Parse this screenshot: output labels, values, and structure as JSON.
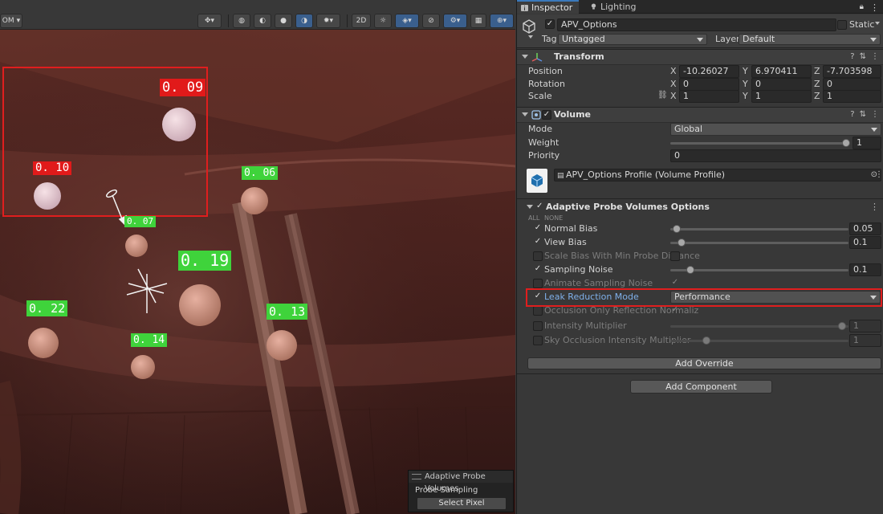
{
  "scene": {
    "toolbar": {
      "left_dropdown": "OM",
      "view_2d": "2D"
    },
    "probes": [
      {
        "label": "0. 09",
        "style": "red"
      },
      {
        "label": "0. 10",
        "style": "red"
      },
      {
        "label": "0. 06",
        "style": "green"
      },
      {
        "label": "0. 07",
        "style": "green"
      },
      {
        "label": "0. 19",
        "style": "green"
      },
      {
        "label": "0. 22",
        "style": "green"
      },
      {
        "label": "0. 14",
        "style": "green"
      },
      {
        "label": "0. 13",
        "style": "green"
      }
    ],
    "overlay": {
      "title": "Adaptive Probe Volumes",
      "subtitle": "Probe Sampling",
      "button": "Select Pixel"
    }
  },
  "inspector": {
    "tabs": [
      {
        "label": "Inspector",
        "icon": "info-icon",
        "active": true
      },
      {
        "label": "Lighting",
        "icon": "bulb-icon",
        "active": false
      }
    ],
    "object": {
      "name": "APV_Options",
      "static_label": "Static",
      "tag_label": "Tag",
      "tag_value": "Untagged",
      "layer_label": "Layer",
      "layer_value": "Default"
    },
    "transform": {
      "title": "Transform",
      "position_label": "Position",
      "rotation_label": "Rotation",
      "scale_label": "Scale",
      "position": {
        "x": "-10.26027",
        "y": "6.970411",
        "z": "-7.703598"
      },
      "rotation": {
        "x": "0",
        "y": "0",
        "z": "0"
      },
      "scale": {
        "x": "1",
        "y": "1",
        "z": "1"
      }
    },
    "volume": {
      "title": "Volume",
      "mode_label": "Mode",
      "mode_value": "Global",
      "weight_label": "Weight",
      "weight_value": "1",
      "priority_label": "Priority",
      "priority_value": "0",
      "profile_value": "APV_Options Profile (Volume Profile)"
    },
    "apv": {
      "title": "Adaptive Probe Volumes Options",
      "all_label": "ALL",
      "none_label": "NONE",
      "rows": [
        {
          "label": "Normal Bias",
          "value": "0.05",
          "override": true,
          "slider": 0.02
        },
        {
          "label": "View Bias",
          "value": "0.1",
          "override": true,
          "slider": 0.05
        },
        {
          "label": "Scale Bias With Min Probe Distance",
          "override": false
        },
        {
          "label": "Sampling Noise",
          "value": "0.1",
          "override": true,
          "slider": 0.1
        },
        {
          "label": "Animate Sampling Noise",
          "override": false
        },
        {
          "label": "Leak Reduction Mode",
          "value": "Performance",
          "override": true
        },
        {
          "label": "Occlusion Only Reflection Normaliz",
          "override": false
        },
        {
          "label": "Intensity Multiplier",
          "value": "1",
          "override": false,
          "slider": 1.0
        },
        {
          "label": "Sky Occlusion Intensity Multiplier",
          "value": "1",
          "override": false,
          "slider": 0.2
        }
      ],
      "add_override": "Add Override"
    },
    "add_component": "Add Component"
  },
  "colors": {
    "highlight": "#e01e1e",
    "green_label": "#3fd33b",
    "red_label": "#e11a1a",
    "accent_blue": "#3a79bb"
  }
}
